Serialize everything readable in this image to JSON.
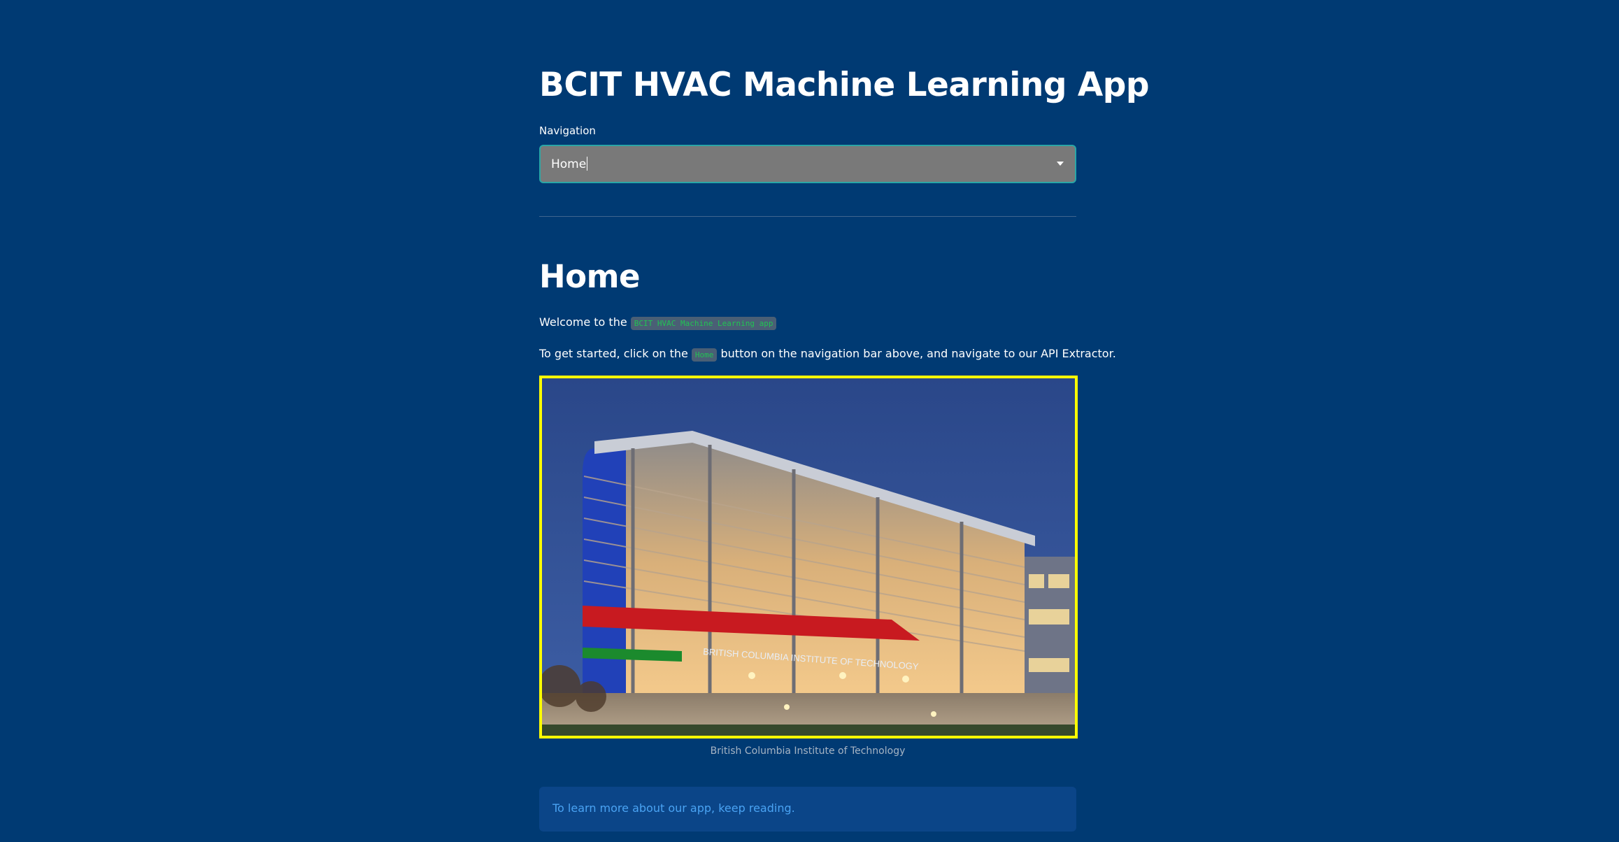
{
  "app": {
    "title": "BCIT HVAC Machine Learning App"
  },
  "navigation": {
    "label": "Navigation",
    "selected": "Home"
  },
  "page": {
    "heading": "Home",
    "welcome_prefix": "Welcome to the ",
    "welcome_code": "BCIT HVAC Machine Learning app",
    "instructions_prefix": "To get started, click on the ",
    "instructions_code": "Home",
    "instructions_suffix": " button on the navigation bar above, and navigate to our API Extractor.",
    "image_caption": "British Columbia Institute of Technology",
    "info_text": "To learn more about our app, keep reading."
  },
  "building_sign": "BRITISH COLUMBIA INSTITUTE OF TECHNOLOGY",
  "colors": {
    "background": "#003a73",
    "image_border": "#ffff00",
    "select_border": "#2aa6a6",
    "code_text": "#21c354",
    "info_text": "#4aa3f3"
  },
  "icons": {
    "select_chevron": "chevron-down-icon"
  }
}
